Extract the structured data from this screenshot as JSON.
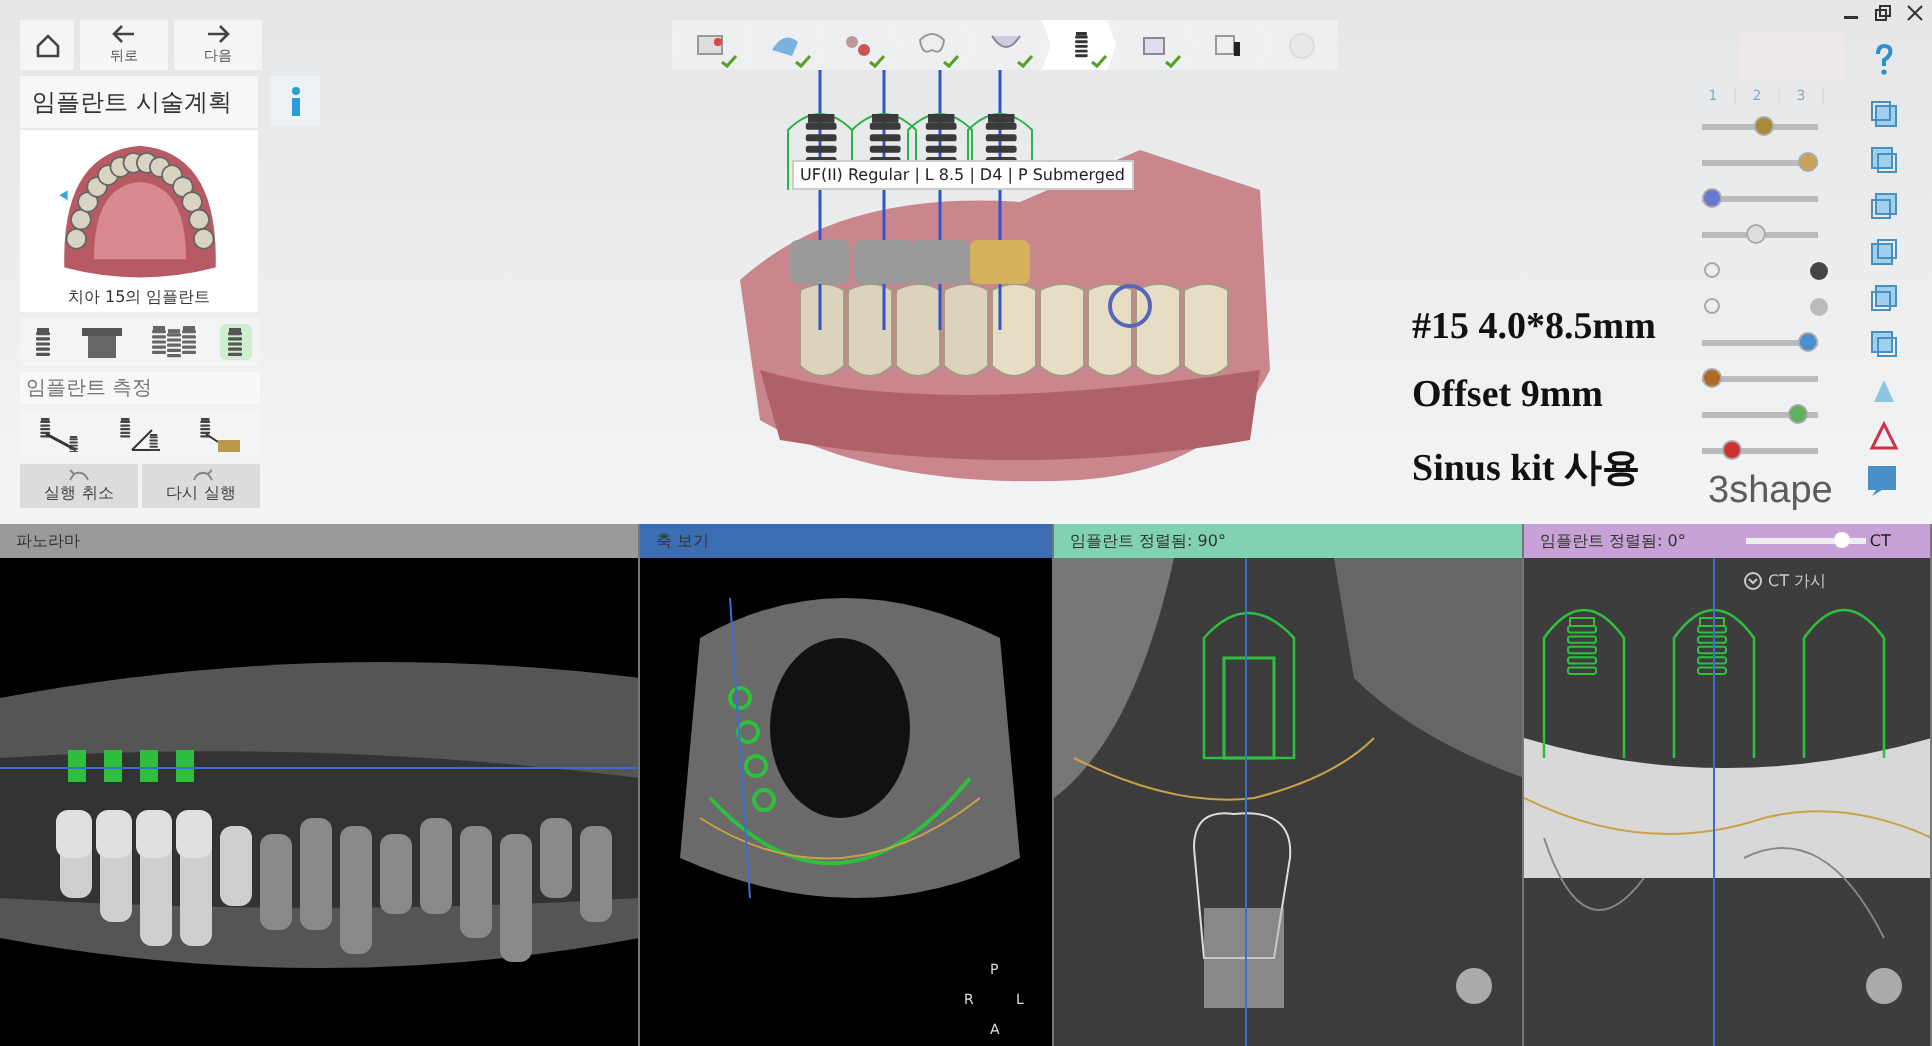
{
  "nav": {
    "buttons": [
      {
        "label": "뒤로",
        "kind": "back"
      },
      {
        "label": "다음",
        "kind": "next"
      }
    ]
  },
  "plan_panel": {
    "title": "임플란트 시술계획",
    "caption": "치아 15의 임플란트",
    "implant_tools": [
      {
        "selected": false
      },
      {
        "selected": false
      },
      {
        "selected": false
      },
      {
        "selected": true
      }
    ],
    "measure_title": "임플란트 측정",
    "history_buttons": [
      {
        "label": "실행 취소",
        "kind": "undo"
      },
      {
        "label": "다시 실행",
        "kind": "redo"
      }
    ]
  },
  "steps": [
    {
      "checked": true,
      "selected": false,
      "disabled": false
    },
    {
      "checked": true,
      "selected": false,
      "disabled": false
    },
    {
      "checked": true,
      "selected": false,
      "disabled": false
    },
    {
      "checked": true,
      "selected": false,
      "disabled": false
    },
    {
      "checked": true,
      "selected": false,
      "disabled": false
    },
    {
      "checked": true,
      "selected": true,
      "disabled": false
    },
    {
      "checked": true,
      "selected": false,
      "disabled": false
    },
    {
      "checked": false,
      "selected": false,
      "disabled": false
    },
    {
      "checked": false,
      "selected": false,
      "disabled": true
    }
  ],
  "model_view": {
    "tooltip": "UF(II) Regular | L 8.5 | D4 | P Submerged"
  },
  "annotations": [
    "#15 4.0*8.5mm",
    "Offset 9mm",
    "Sinus kit 사용"
  ],
  "right_panel": {
    "view_tabs": [
      {
        "label": "1",
        "selected": false
      },
      {
        "label": "2",
        "selected": false
      },
      {
        "label": "3",
        "selected": false
      }
    ],
    "layers": [
      {
        "kind": "slider",
        "level": 0.55
      },
      {
        "kind": "slider",
        "level": 1
      },
      {
        "kind": "slider",
        "level": 0
      },
      {
        "kind": "slider",
        "level": 0.45
      },
      {
        "kind": "switch",
        "on": true
      },
      {
        "kind": "switch",
        "on": false
      },
      {
        "kind": "slider",
        "level": 1
      },
      {
        "kind": "slider",
        "level": 0
      },
      {
        "kind": "slider",
        "level": 0.9
      },
      {
        "kind": "slider",
        "level": 0.2
      }
    ],
    "brand": "3shape"
  },
  "views": [
    {
      "kind": "panoramic",
      "title": "파노라마",
      "color": "#9a9a9a"
    },
    {
      "kind": "axial",
      "title": "축 보기",
      "color": "#3b6db2",
      "orientation": [
        "P",
        "R",
        "L",
        "A"
      ]
    },
    {
      "kind": "cross",
      "title": "임플란트 정렬됨: 90°",
      "color": "#80d2b2"
    },
    {
      "kind": "tangential",
      "title": "임플란트 정렬됨: 0°",
      "color": "#c7a2d6",
      "slider_label": "CT",
      "level": 0.8,
      "toggle_label": "CT 가시"
    }
  ]
}
